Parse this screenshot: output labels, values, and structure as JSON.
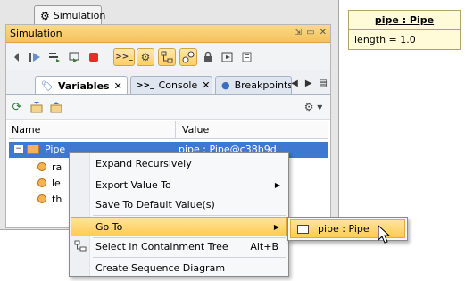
{
  "window": {
    "top_tab_label": "Simulation",
    "panel_title": "Simulation",
    "title_buttons": [
      "⇲",
      "▭",
      "✕"
    ]
  },
  "tabs": [
    {
      "label": "Variables",
      "active": true
    },
    {
      "label": "Console",
      "active": false
    },
    {
      "label": "Breakpoints",
      "active": false
    }
  ],
  "tab_controls": [
    "◀",
    "▶",
    "▤"
  ],
  "table": {
    "headers": [
      "Name",
      "Value"
    ],
    "rows": [
      {
        "name": "Pipe",
        "value": "pipe : Pipe@c38b9d",
        "selected": true
      },
      {
        "name": "ra",
        "value": ""
      },
      {
        "name": "le",
        "value": ""
      },
      {
        "name": "th",
        "value": ""
      }
    ]
  },
  "context_menu": {
    "items": [
      {
        "label": "Expand Recursively"
      },
      {
        "label": "Export Value To",
        "submenu": true
      },
      {
        "label": "Save To Default Value(s)"
      },
      {
        "label": "Go To",
        "submenu": true,
        "highlighted": true
      },
      {
        "label": "Select in Containment Tree",
        "shortcut": "Alt+B"
      },
      {
        "label": "Create Sequence Diagram"
      }
    ]
  },
  "submenu": {
    "label": "pipe : Pipe"
  },
  "instance": {
    "name": "pipe : Pipe",
    "attribute": "length = 1.0"
  },
  "colors": {
    "accent_orange": "#f5c25a",
    "selection_blue": "#3f78d1",
    "instance_fill": "#fffbd8"
  }
}
